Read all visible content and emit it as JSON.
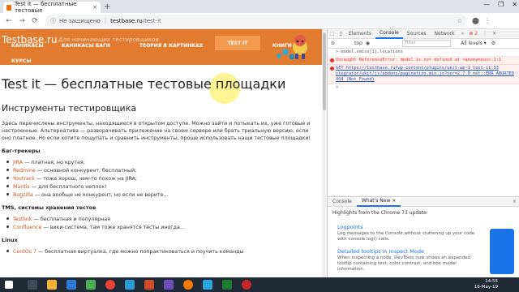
{
  "browser": {
    "tab_title": "Test it — бесплатные тестовые",
    "tab_close": "×",
    "new_tab": "+",
    "window_controls": [
      "—",
      "❐",
      "✕"
    ],
    "nav": [
      "←",
      "→",
      "⟳"
    ],
    "security_label": "Не защищено",
    "url_host": "testbase.ru",
    "url_path": "/test-it",
    "star": "☆",
    "toolbar_icons": [
      "⬤",
      "⋮"
    ]
  },
  "site": {
    "title": "Testbase.ru",
    "tagline": "Для начинающих тестировщиков",
    "menu": [
      {
        "label": "КАНИКАСЫ"
      },
      {
        "label": "КАНИКАСЫ БАГИ"
      },
      {
        "label": "ТЕОРИЯ В КАРТИНКАХ"
      },
      {
        "label": "TEST IT"
      },
      {
        "label": "КНИГИ"
      }
    ],
    "menu_second_row": "КУРСЫ"
  },
  "article": {
    "h1": "Test it — бесплатные тестовые площадки",
    "h2": "Инструменты тестировщика",
    "intro": "Здесь перечислены инструменты, находящиеся в открытом доступе. Можно зайти и потыкать их, уже готовые и настроенные. Альтернатива — разворачивать приложение на своем сервере или брать триальную версию, если оно платное. Но если хотите пощупать и сравнить инструменты, проще использовать наши тестовые площадки!",
    "sections": [
      {
        "heading": "Баг-трекеры",
        "items": [
          {
            "name": "JIRA",
            "desc": " — платная, но крутая;"
          },
          {
            "name": "Redmine",
            "desc": " — основной конкурент, бесплатный;"
          },
          {
            "name": "Youtrack",
            "desc": " — тоже хорош, чем-то похож на JIRA;"
          },
          {
            "name": "Mantis",
            "desc": " — для бесплатного неплох!"
          },
          {
            "name": "Bugzilla",
            "desc": " — она вообще не конкурент, но если не верите…"
          }
        ]
      },
      {
        "heading": "TMS, системы хранения тестов",
        "items": [
          {
            "name": "Testlink",
            "desc": " — бесплатная и популярная"
          },
          {
            "name": "Confluence",
            "desc": " — вики-система, там тоже хранятся тесты иногда…"
          }
        ]
      },
      {
        "heading": "Linux",
        "items": [
          {
            "name": "CentOs 7",
            "desc": " — бесплатная виртуалка, где можно попрактиковаться и поучить команды"
          }
        ]
      }
    ]
  },
  "devtools": {
    "tabs": [
      "Elements",
      "Console",
      "Sources",
      "Network"
    ],
    "active_tab": "Console",
    "more": "»",
    "error_count": "⊗ 2",
    "context": "top",
    "filter_placeholder": "Filter",
    "levels": "All levels ▾",
    "messages": [
      {
        "type": "log",
        "text": "> model.smiss[1].locations"
      },
      {
        "type": "error",
        "text": "Uncaught ReferenceError: model is not defined at <anonymous>:1:1"
      },
      {
        "type": "error",
        "text": "GET https://testbase.ru/wp-content/plugins/ukit-wp-1 test-it:33 ntegrator/ukit/js/addons/pagination.min.js?ver=2.7.0 net::ERR_ABORTED 404 (Not Found)"
      },
      {
        "type": "prompt",
        "text": ">"
      }
    ],
    "drawer_tabs": [
      "Console",
      "What's New ×"
    ],
    "drawer_active": "What's New ×",
    "drawer_close": "×",
    "whats_new_head": "Highlights from the Chrome 73 update",
    "features": [
      {
        "title": "Logpoints",
        "desc": "Log messages to the Console without cluttering up your code with console.log() calls."
      },
      {
        "title": "Detailed tooltips in Inspect Mode",
        "desc": "When inspecting a node, DevTools now shows an expanded tooltip containing text, color contrast, and box model information."
      }
    ]
  },
  "taskbar": {
    "time": "14:55",
    "date": "16-May-19"
  },
  "colors": {
    "navbar": "#e07b2f",
    "link": "#c8501f",
    "error": "#e0301e",
    "devtools_accent": "#1a73e8"
  }
}
